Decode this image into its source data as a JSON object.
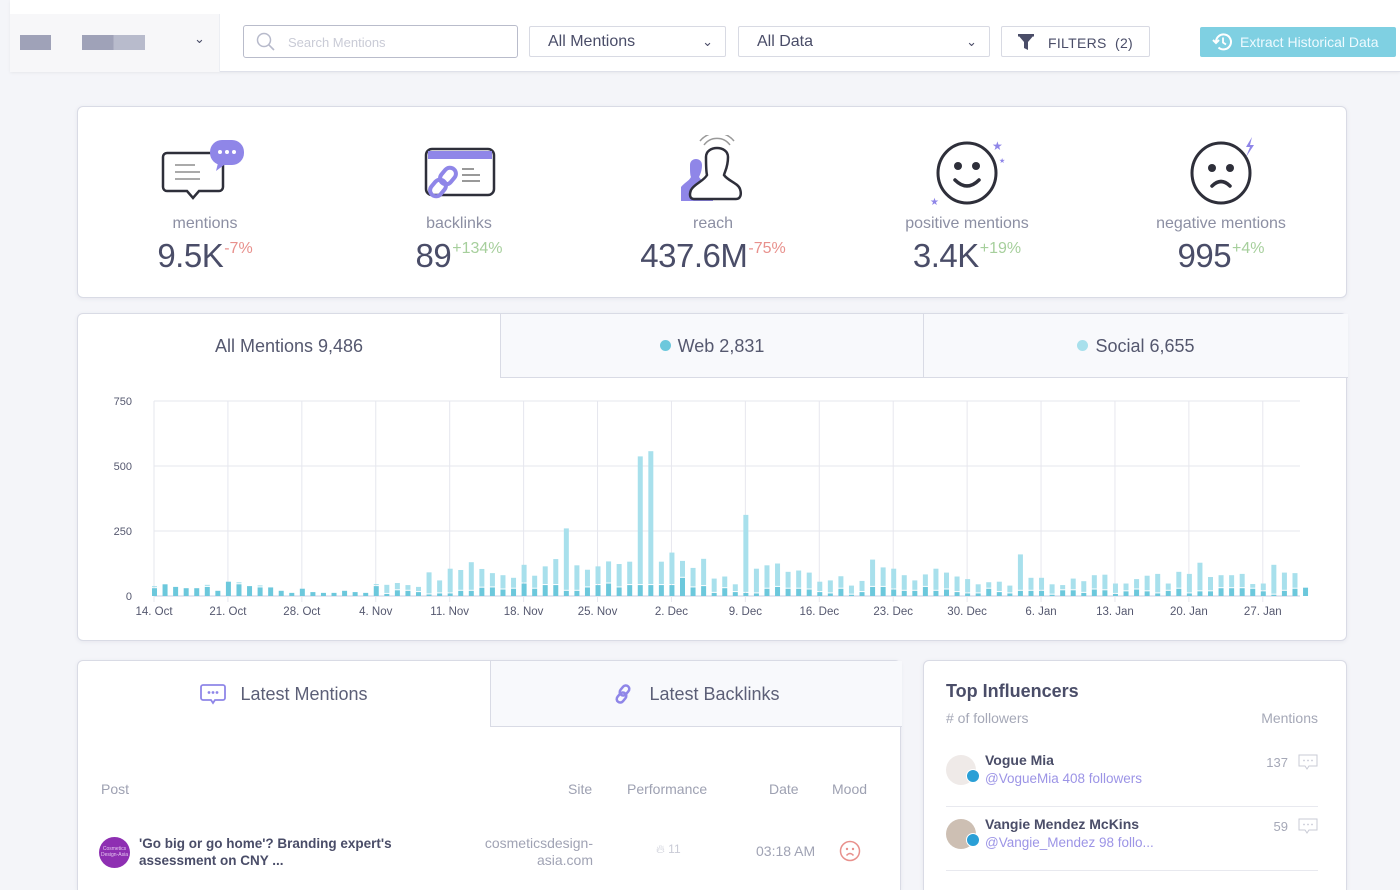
{
  "topbar": {
    "search_placeholder": "Search Mentions",
    "search_value": "",
    "mentions_dropdown": "All Mentions",
    "data_dropdown": "All Data",
    "filters_label": "FILTERS  (2)",
    "filters_count": 2,
    "extract_label": "Extract Historical Data",
    "accent_color": "#7fd0e2"
  },
  "stats": [
    {
      "icon": "chat-bubble-icon",
      "label": "mentions",
      "value": "9.5K",
      "delta": "-7%",
      "trend": "negative"
    },
    {
      "icon": "backlink-icon",
      "label": "backlinks",
      "value": "89",
      "delta": "+134%",
      "trend": "positive"
    },
    {
      "icon": "reach-icon",
      "label": "reach",
      "value": "437.6M",
      "delta": "-75%",
      "trend": "negative"
    },
    {
      "icon": "happy-face-icon",
      "label": "positive mentions",
      "value": "3.4K",
      "delta": "+19%",
      "trend": "positive"
    },
    {
      "icon": "sad-face-icon",
      "label": "negative mentions",
      "value": "995",
      "delta": "+4%",
      "trend": "positive"
    }
  ],
  "chart_tabs": [
    {
      "label": "All Mentions 9,486",
      "active": true
    },
    {
      "label": "Web 2,831",
      "dot_color": "#6cc8dc",
      "active": false
    },
    {
      "label": "Social 6,655",
      "dot_color": "#a8e0ec",
      "active": false
    }
  ],
  "chart_data": {
    "type": "bar",
    "stacked": true,
    "title": "",
    "xlabel": "",
    "ylabel": "",
    "ylim": [
      0,
      750
    ],
    "yticks": [
      0,
      250,
      500,
      750
    ],
    "grid": true,
    "start_date": "14. Oct",
    "xtick_labels": [
      "14. Oct",
      "21. Oct",
      "28. Oct",
      "4. Nov",
      "11. Nov",
      "18. Nov",
      "25. Nov",
      "2. Dec",
      "9. Dec",
      "16. Dec",
      "23. Dec",
      "30. Dec",
      "6. Jan",
      "13. Jan",
      "20. Jan",
      "27. Jan"
    ],
    "xtick_every_days": 7,
    "series": [
      {
        "name": "Web",
        "color": "#6cc8dc",
        "values": [
          30,
          45,
          35,
          30,
          30,
          35,
          20,
          55,
          45,
          38,
          33,
          33,
          20,
          12,
          28,
          15,
          12,
          12,
          20,
          15,
          12,
          38,
          8,
          22,
          20,
          15,
          6,
          10,
          10,
          20,
          20,
          32,
          33,
          25,
          28,
          48,
          28,
          42,
          42,
          20,
          20,
          33,
          42,
          48,
          33,
          42,
          42,
          42,
          42,
          42,
          70,
          33,
          38,
          12,
          30,
          15,
          12,
          10,
          28,
          35,
          28,
          28,
          25,
          15,
          10,
          28,
          5,
          15,
          35,
          35,
          25,
          20,
          20,
          35,
          20,
          25,
          15,
          10,
          10,
          28,
          15,
          10,
          20,
          20,
          20,
          5,
          22,
          22,
          12,
          25,
          22,
          8,
          18,
          25,
          18,
          10,
          20,
          28,
          10,
          18,
          18,
          30,
          30,
          30,
          28,
          18,
          5,
          20,
          28,
          32
        ],
        "note": "daily web mentions (dark segment), estimated"
      },
      {
        "name": "Social",
        "color": "#a8e0ec",
        "values": [
          8,
          0,
          0,
          0,
          0,
          8,
          0,
          0,
          8,
          0,
          8,
          0,
          0,
          0,
          0,
          0,
          0,
          0,
          0,
          0,
          0,
          8,
          35,
          28,
          22,
          20,
          85,
          50,
          95,
          80,
          110,
          72,
          55,
          55,
          42,
          72,
          50,
          72,
          100,
          240,
          98,
          68,
          72,
          85,
          90,
          90,
          495,
          515,
          90,
          125,
          65,
          75,
          105,
          55,
          45,
          30,
          300,
          95,
          90,
          90,
          65,
          70,
          65,
          40,
          50,
          48,
          35,
          43,
          105,
          75,
          80,
          60,
          40,
          48,
          85,
          65,
          60,
          55,
          35,
          25,
          40,
          30,
          140,
          50,
          50,
          40,
          20,
          45,
          45,
          55,
          60,
          40,
          30,
          40,
          60,
          75,
          28,
          65,
          75,
          110,
          55,
          50,
          50,
          55,
          18,
          30,
          115,
          70,
          60
        ],
        "note": "daily social mentions (light segment stacked on web), estimated"
      }
    ]
  },
  "mentions_tabs": [
    {
      "label": "Latest Mentions",
      "icon": "chat-icon",
      "active": true
    },
    {
      "label": "Latest Backlinks",
      "icon": "link-icon",
      "active": false
    }
  ],
  "mentions_table": {
    "columns": [
      "Post",
      "Site",
      "Performance",
      "Date",
      "Mood"
    ],
    "rows": [
      {
        "avatar_text": "Cosmetics Design-Asia",
        "post": "'Go big or go home'? Branding expert's assessment on CNY ...",
        "site": "cosmeticsdesign-asia.com",
        "performance": "11",
        "date": "03:18 AM",
        "mood": "negative"
      }
    ]
  },
  "influencers": {
    "title": "Top Influencers",
    "col_left": "# of followers",
    "col_right": "Mentions",
    "rows": [
      {
        "name": "Vogue Mia",
        "handle": "@VogueMia 408 followers",
        "mentions": "137"
      },
      {
        "name": "Vangie Mendez McKins",
        "handle": "@Vangie_Mendez 98 follo...",
        "mentions": "59"
      }
    ]
  }
}
